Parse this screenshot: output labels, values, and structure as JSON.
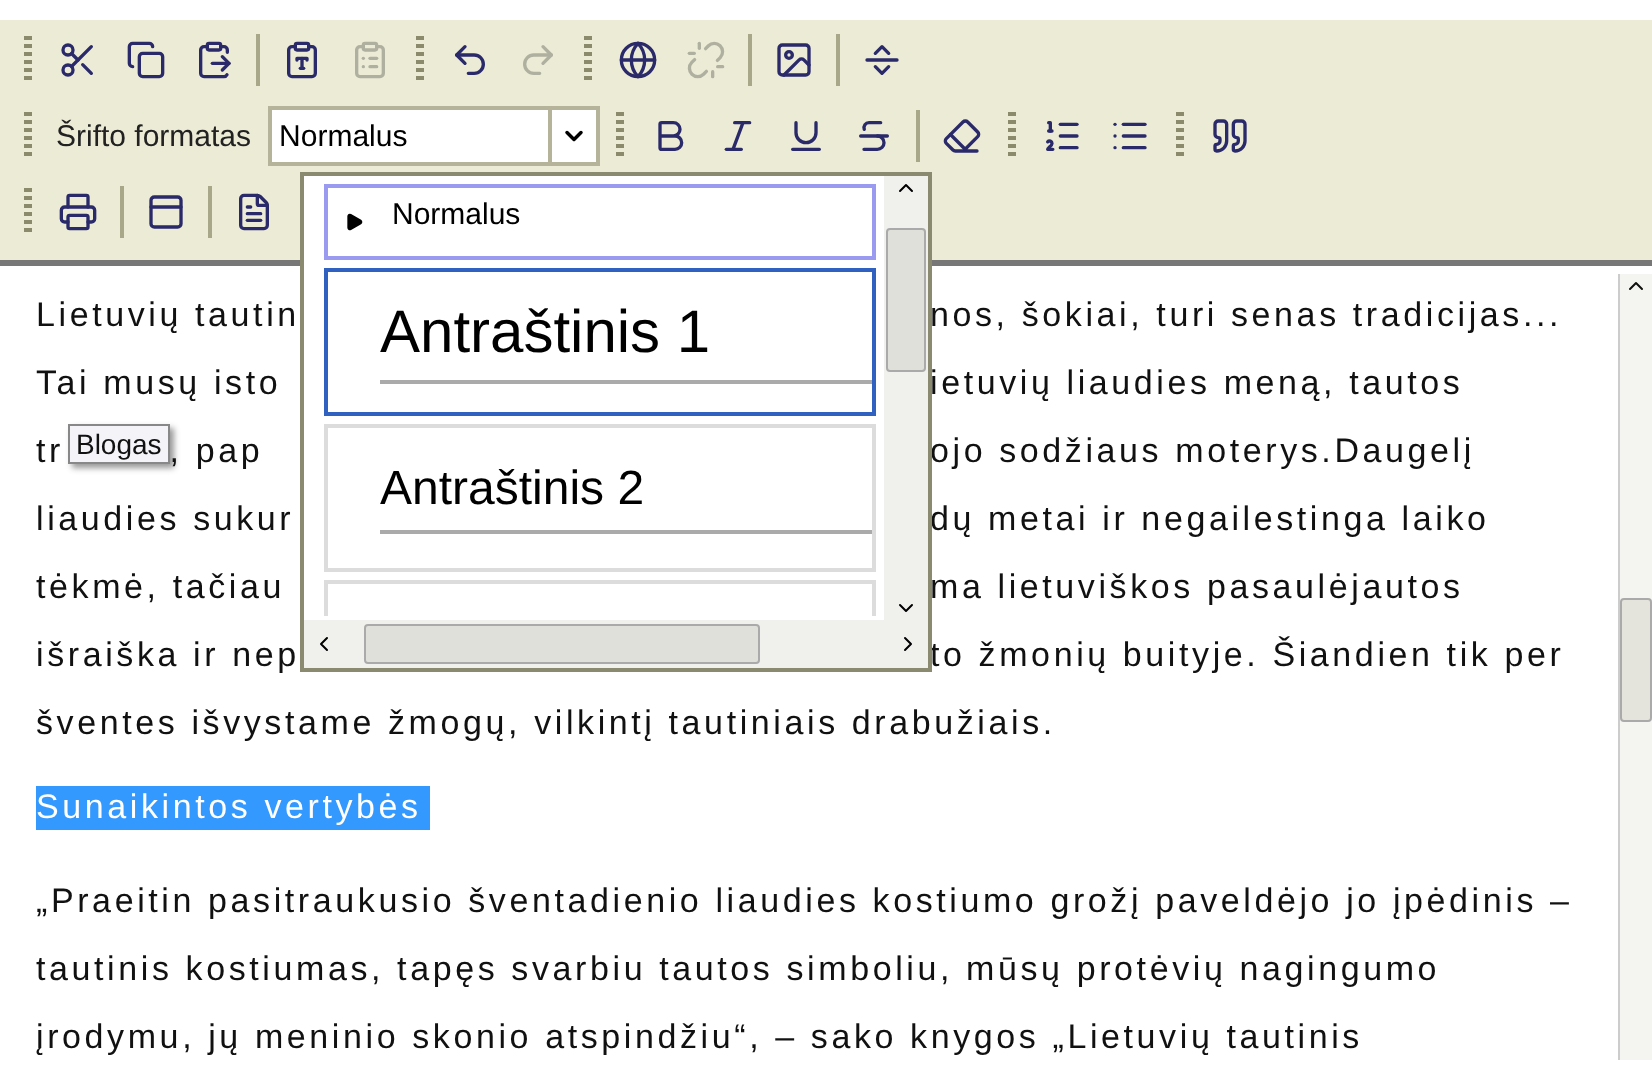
{
  "toolbar": {
    "rows": [
      {
        "items": [
          {
            "kind": "grip"
          },
          {
            "kind": "button",
            "disabled": false
          },
          {
            "kind": "button",
            "disabled": false
          },
          {
            "kind": "button",
            "disabled": false
          },
          {
            "kind": "separator"
          },
          {
            "kind": "button",
            "disabled": false
          },
          {
            "kind": "button",
            "disabled": true
          },
          {
            "kind": "grip"
          },
          {
            "kind": "button",
            "disabled": false
          },
          {
            "kind": "button",
            "disabled": true
          },
          {
            "kind": "grip"
          },
          {
            "kind": "button",
            "disabled": false
          },
          {
            "kind": "button",
            "disabled": true
          },
          {
            "kind": "separator"
          },
          {
            "kind": "button",
            "disabled": false
          },
          {
            "kind": "separator"
          },
          {
            "kind": "button",
            "disabled": false
          }
        ]
      },
      {
        "items": [
          {
            "kind": "grip"
          },
          {
            "kind": "label",
            "text": "Šrifto formatas"
          },
          {
            "kind": "select",
            "value": "Normalus"
          },
          {
            "kind": "grip"
          },
          {
            "kind": "button",
            "disabled": false
          },
          {
            "kind": "button",
            "disabled": false
          },
          {
            "kind": "button",
            "disabled": false
          },
          {
            "kind": "button",
            "disabled": false
          },
          {
            "kind": "separator"
          },
          {
            "kind": "button",
            "disabled": false
          },
          {
            "kind": "grip"
          },
          {
            "kind": "button",
            "disabled": false
          },
          {
            "kind": "button",
            "disabled": false
          },
          {
            "kind": "grip"
          },
          {
            "kind": "button",
            "disabled": false
          }
        ]
      },
      {
        "items": [
          {
            "kind": "grip"
          },
          {
            "kind": "button",
            "disabled": false
          },
          {
            "kind": "separator"
          },
          {
            "kind": "button",
            "disabled": false
          },
          {
            "kind": "separator"
          },
          {
            "kind": "button",
            "disabled": false
          }
        ]
      }
    ]
  },
  "format_dropdown": {
    "items": [
      {
        "kind": "normal",
        "label": "Normalus",
        "selected": false,
        "current": true
      },
      {
        "kind": "heading1",
        "label": "Antraštinis 1",
        "selected": true,
        "current": false
      },
      {
        "kind": "heading2",
        "label": "Antraštinis 2",
        "selected": false,
        "current": false
      },
      {
        "kind": "heading3",
        "selected": false,
        "current": false
      }
    ]
  },
  "editor": {
    "lines": [
      {
        "left": "Lietuvių tautin",
        "right": "nos, šokiai, turi senas tradicijas..."
      },
      {
        "left": "Tai musų isto",
        "right": "ietuvių liaudies meną, tautos"
      },
      {
        "left": "tr",
        "tooltip": "Blogas",
        "left_after": ", pap",
        "right": "ojo sodžiaus moterys.Daugelį"
      },
      {
        "left": "liaudies sukur",
        "right": "dų metai ir negailestinga laiko"
      },
      {
        "left": "tėkmė, tačiau",
        "right": "ma lietuviškos pasaulėjautos"
      },
      {
        "left": "išraiška ir nep",
        "right": "to žmonių buityje. Šiandien tik per"
      }
    ],
    "full_line": "šventes išvystame žmogų, vilkintį tautiniais drabužiais.",
    "heading": {
      "text": "Sunaikintos vertybės",
      "selected": true
    },
    "paragraph": "„Praeitin pasitraukusio šventadienio liaudies kostiumo grožį paveldėjo jo įpėdinis – tautinis kostiumas, tapęs svarbiu tautos simboliu, mūsų protėvių nagingumo įrodymu, jų meninio skonio atspindžiu“, – sako knygos „Lietuvių tautinis"
  }
}
